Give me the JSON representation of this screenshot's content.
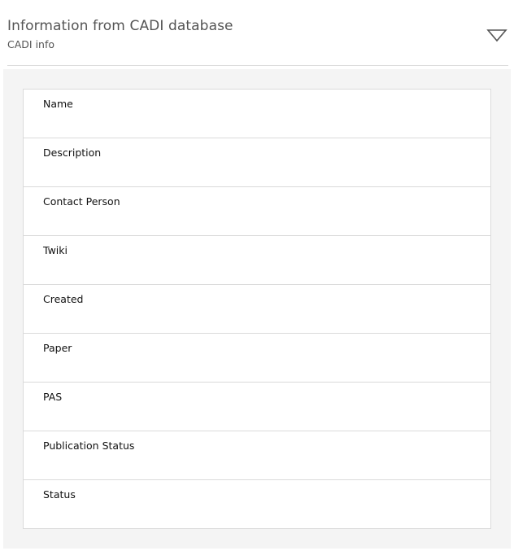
{
  "header": {
    "title": "Information from CADI database",
    "subtitle": "CADI info",
    "toggle_icon": "triangle-down-outline-icon"
  },
  "table": {
    "rows": [
      {
        "label": "Name",
        "value": ""
      },
      {
        "label": "Description",
        "value": ""
      },
      {
        "label": "Contact Person",
        "value": ""
      },
      {
        "label": "Twiki",
        "value": ""
      },
      {
        "label": "Created",
        "value": ""
      },
      {
        "label": "Paper",
        "value": ""
      },
      {
        "label": "PAS",
        "value": ""
      },
      {
        "label": "Publication Status",
        "value": ""
      },
      {
        "label": "Status",
        "value": ""
      }
    ]
  },
  "colors": {
    "header_text": "#555555",
    "body_background": "#f4f4f4",
    "table_border": "#dadada"
  }
}
